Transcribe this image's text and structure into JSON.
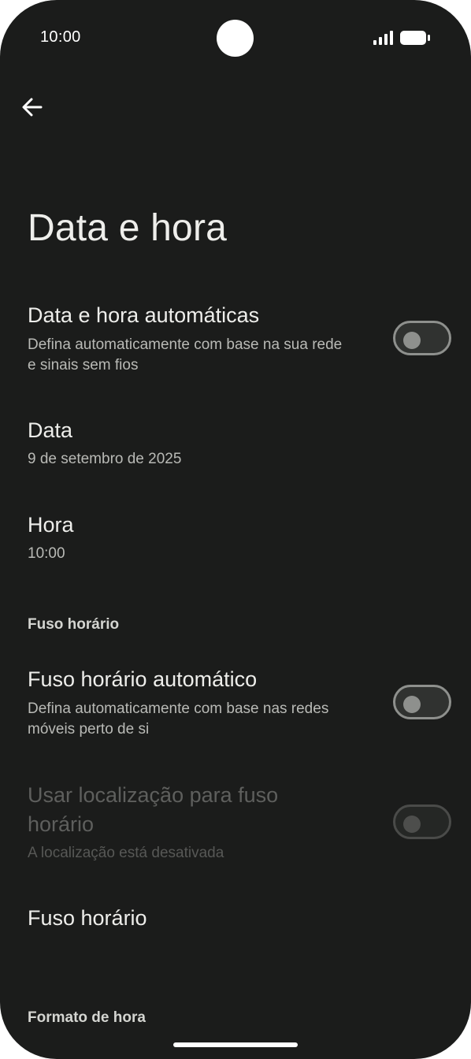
{
  "status_bar": {
    "time": "10:00"
  },
  "header": {
    "title": "Data e hora"
  },
  "automatic_datetime": {
    "title": "Data e hora automáticas",
    "subtitle_line1": "Defina automaticamente com base na sua rede",
    "subtitle_line2": "e sinais sem fios",
    "enabled": false
  },
  "date": {
    "title": "Data",
    "value": "9 de setembro de 2025"
  },
  "time": {
    "title": "Hora",
    "value": "10:00"
  },
  "timezone_section": {
    "header": "Fuso horário",
    "automatic_timezone": {
      "title": "Fuso horário automático",
      "subtitle_line1": "Defina automaticamente com base nas redes",
      "subtitle_line2": "móveis perto de si",
      "enabled": false
    },
    "use_location": {
      "title_line1": "Usar localização para fuso",
      "title_line2": "horário",
      "subtitle": "A localização está desativada",
      "enabled": false,
      "disabled": true
    },
    "timezone": {
      "title": "Fuso horário"
    }
  },
  "time_format_section": {
    "header": "Formato de hora"
  },
  "colors": {
    "background": "#1b1c1b",
    "text_primary": "#eeeeeb",
    "text_secondary": "#b9bab6",
    "toggle_outline": "#8e908d"
  }
}
